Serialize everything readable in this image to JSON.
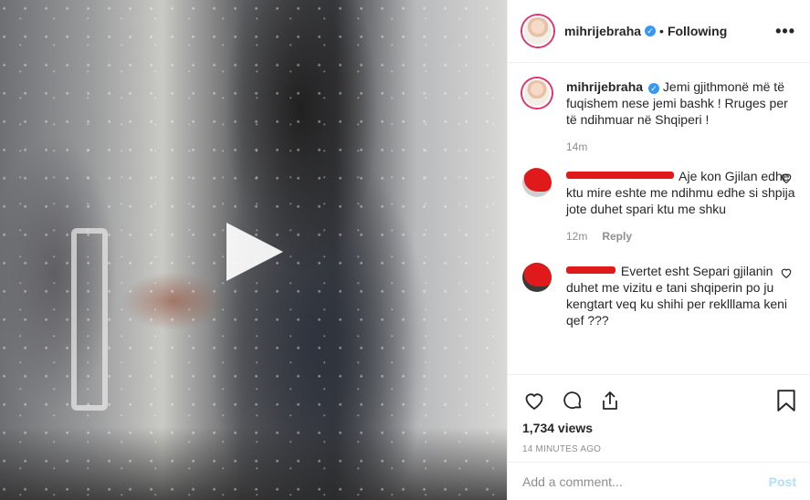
{
  "post": {
    "username": "mihrijebraha",
    "separator": "•",
    "follow_status": "Following",
    "more_label": "•••"
  },
  "caption": {
    "username": "mihrijebraha",
    "text": "Jemi gjithmonë më të fuqishem nese jemi bashk ! Rruges per të ndihmuar në Shqiperi !",
    "time": "14m"
  },
  "comments": [
    {
      "text": "Aje kon Gjilan edhe ktu mire eshte me ndihmu edhe si shpija jote duhet spari ktu me shku",
      "time": "12m",
      "reply_label": "Reply"
    },
    {
      "text": "Evertet esht Separi gjilanin duhet me vizitu e tani shqiperin po ju kengtart veq ku shihi per reklllama keni qef ???"
    }
  ],
  "stats": {
    "views": "1,734 views",
    "time_ago": "14 MINUTES AGO"
  },
  "add_comment": {
    "placeholder": "Add a comment...",
    "post_label": "Post"
  },
  "colors": {
    "verified": "#3897f0",
    "post_disabled": "#b2dffc",
    "redaction": "#e01a1a"
  }
}
